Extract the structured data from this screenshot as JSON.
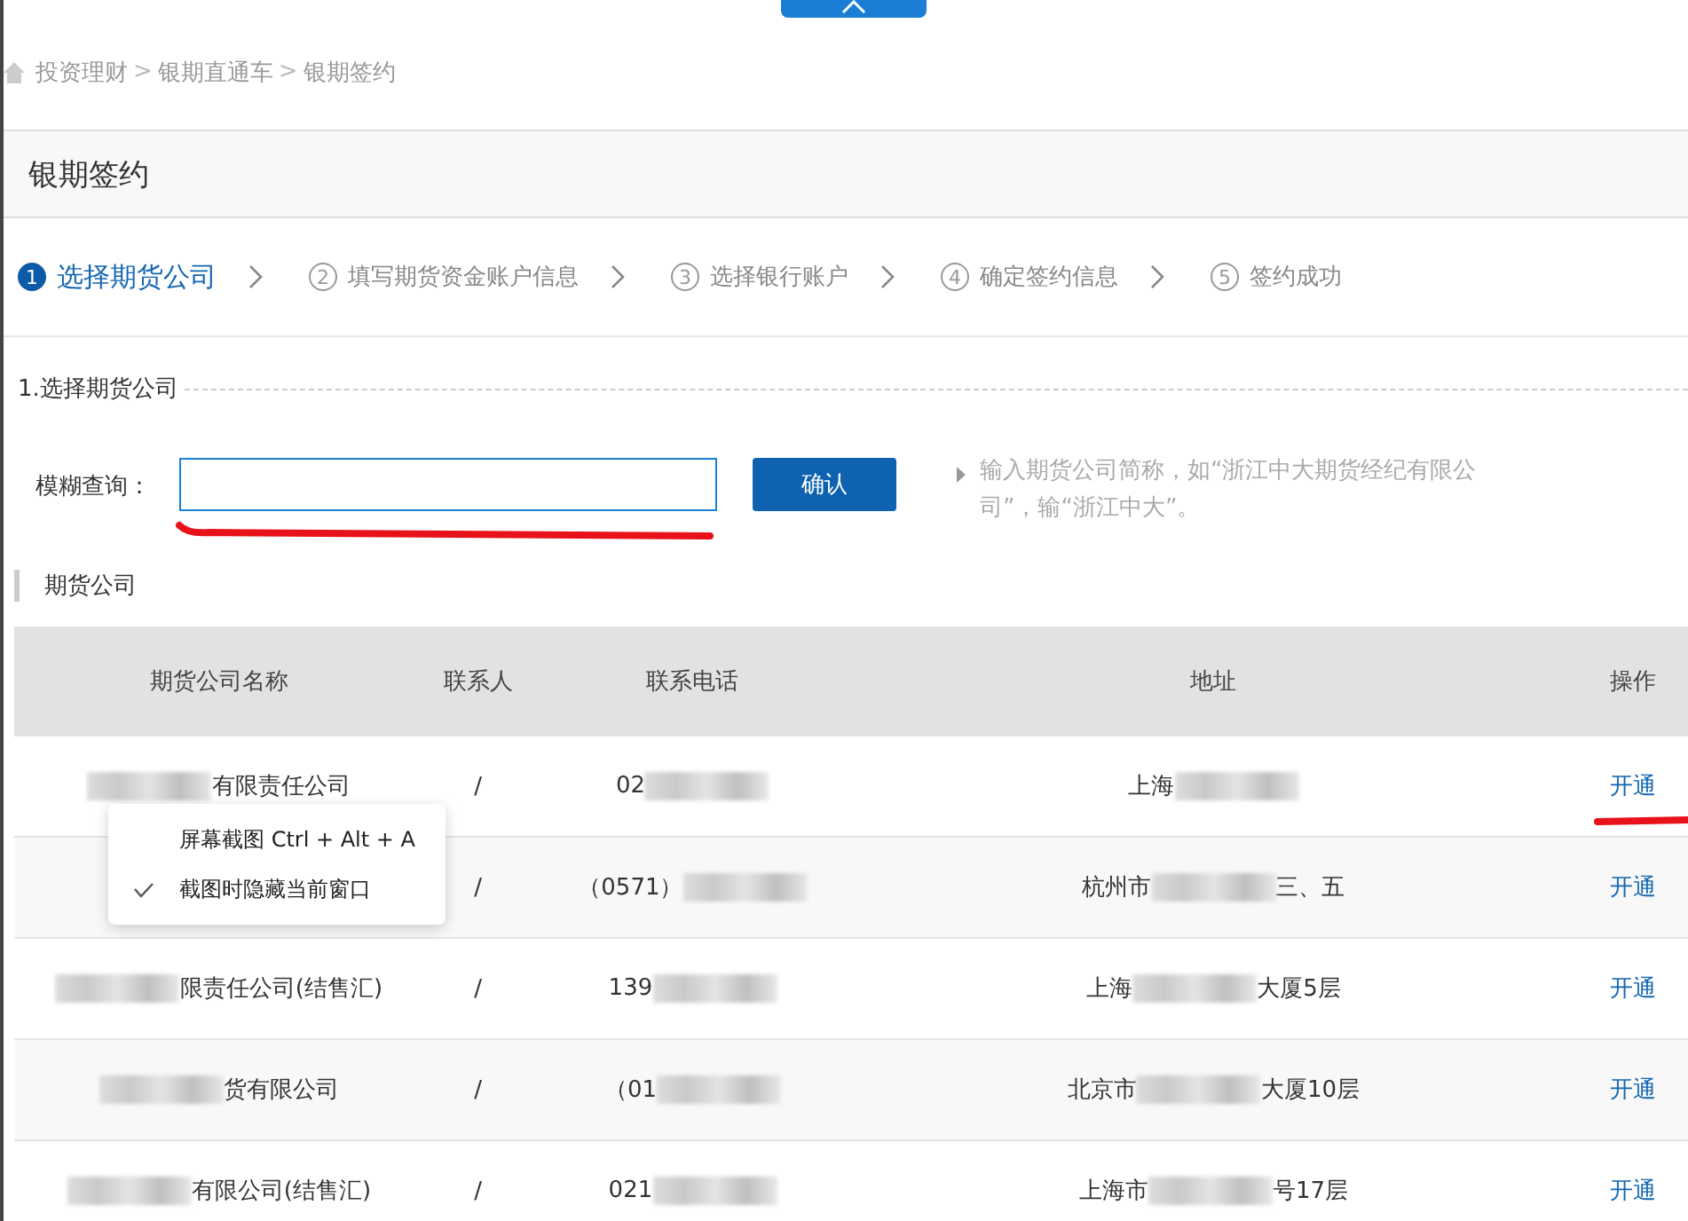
{
  "breadcrumb": [
    "投资理财",
    "银期直通车",
    "银期签约"
  ],
  "breadcrumb_separator": ">",
  "page_title": "银期签约",
  "steps": [
    {
      "number": "1",
      "label": "选择期货公司",
      "selected": true
    },
    {
      "number": "2",
      "label": "填写期货资金账户信息",
      "selected": false
    },
    {
      "number": "3",
      "label": "选择银行账户",
      "selected": false
    },
    {
      "number": "4",
      "label": "确定签约信息",
      "selected": false
    },
    {
      "number": "5",
      "label": "签约成功",
      "selected": false
    }
  ],
  "section_title": "1.选择期货公司",
  "search": {
    "label": "模糊查询：",
    "button": "确认",
    "hint": "输入期货公司简称，如“浙江中大期货经纪有限公司”，输“浙江中大”。"
  },
  "list_title": "期货公司",
  "table": {
    "columns": [
      "期货公司名称",
      "联系人",
      "联系电话",
      "地址",
      "操作"
    ],
    "rows": [
      {
        "cells": [
          [
            {
              "kind": "blur"
            },
            {
              "kind": "text",
              "text": "有限责任公司"
            }
          ],
          [
            {
              "kind": "text",
              "text": "/"
            }
          ],
          [
            {
              "kind": "text",
              "text": "02"
            },
            {
              "kind": "blur"
            }
          ],
          [
            {
              "kind": "text",
              "text": "上海"
            },
            {
              "kind": "blur"
            }
          ]
        ],
        "action": "开通"
      },
      {
        "cells": [
          [],
          [
            {
              "kind": "text",
              "text": "/"
            }
          ],
          [
            {
              "kind": "text",
              "text": "（0571）"
            },
            {
              "kind": "blur"
            }
          ],
          [
            {
              "kind": "text",
              "text": "杭州市"
            },
            {
              "kind": "blur"
            },
            {
              "kind": "text",
              "text": "三、五"
            }
          ]
        ],
        "action": "开通"
      },
      {
        "cells": [
          [
            {
              "kind": "blur"
            },
            {
              "kind": "text",
              "text": "限责任公司(结售汇)"
            }
          ],
          [
            {
              "kind": "text",
              "text": "/"
            }
          ],
          [
            {
              "kind": "text",
              "text": "139"
            },
            {
              "kind": "blur"
            }
          ],
          [
            {
              "kind": "text",
              "text": "上海"
            },
            {
              "kind": "blur"
            },
            {
              "kind": "text",
              "text": "大厦5层"
            }
          ]
        ],
        "action": "开通"
      },
      {
        "cells": [
          [
            {
              "kind": "blur"
            },
            {
              "kind": "text",
              "text": "货有限公司"
            }
          ],
          [
            {
              "kind": "text",
              "text": "/"
            }
          ],
          [
            {
              "kind": "text",
              "text": "（01"
            },
            {
              "kind": "blur"
            }
          ],
          [
            {
              "kind": "text",
              "text": "北京市"
            },
            {
              "kind": "blur"
            },
            {
              "kind": "text",
              "text": "大厦10层"
            }
          ]
        ],
        "action": "开通"
      },
      {
        "cells": [
          [
            {
              "kind": "blur"
            },
            {
              "kind": "text",
              "text": "有限公司(结售汇)"
            }
          ],
          [
            {
              "kind": "text",
              "text": "/"
            }
          ],
          [
            {
              "kind": "text",
              "text": "021"
            },
            {
              "kind": "blur"
            }
          ],
          [
            {
              "kind": "text",
              "text": "上海市"
            },
            {
              "kind": "blur"
            },
            {
              "kind": "text",
              "text": "号17层"
            }
          ]
        ],
        "action": "开通"
      }
    ]
  },
  "context_menu": [
    {
      "label": "屏幕截图 Ctrl + Alt + A",
      "checked": false
    },
    {
      "label": "截图时隐藏当前窗口",
      "checked": true
    }
  ]
}
